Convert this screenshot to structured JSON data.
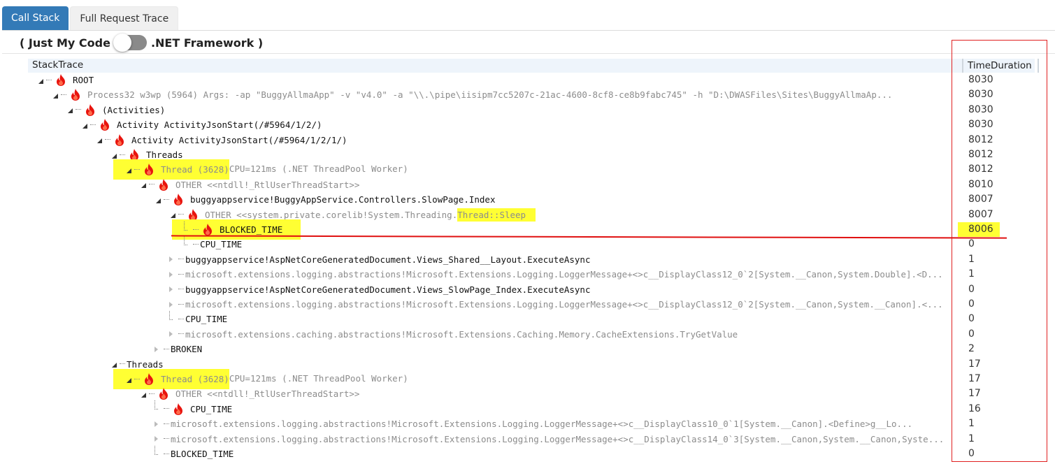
{
  "tabs": [
    {
      "label": "Call Stack",
      "active": true
    },
    {
      "label": "Full Request Trace",
      "active": false
    }
  ],
  "toggle": {
    "left_label": "( Just My Code",
    "right_label": ".NET Framework )",
    "state": "just-my-code"
  },
  "grid": {
    "columns": [
      "StackTrace",
      "TimeDuration"
    ],
    "rows": [
      {
        "label": "ROOT",
        "time": "8030",
        "depth": 0,
        "expander": "open",
        "flame": true,
        "style": "dark"
      },
      {
        "label": "Process32 w3wp (5964) Args: -ap \"BuggyAllmaApp\" -v \"v4.0\" -a \"\\\\.\\pipe\\iisipm7cc5207c-21ac-4600-8cf8-ce8b9fabc745\" -h \"D:\\DWASFiles\\Sites\\BuggyAllmaAp...",
        "time": "8030",
        "depth": 1,
        "expander": "open",
        "flame": true,
        "style": "grey"
      },
      {
        "label": "(Activities)",
        "time": "8030",
        "depth": 2,
        "expander": "open",
        "flame": true,
        "style": "dark"
      },
      {
        "label": "Activity ActivityJsonStart(/#5964/1/2/)",
        "time": "8030",
        "depth": 3,
        "expander": "open",
        "flame": true,
        "style": "dark"
      },
      {
        "label": "Activity ActivityJsonStart(/#5964/1/2/1/)",
        "time": "8012",
        "depth": 4,
        "expander": "open",
        "flame": true,
        "style": "dark"
      },
      {
        "label": "Threads",
        "time": "8012",
        "depth": 5,
        "expander": "open",
        "flame": true,
        "style": "dark"
      },
      {
        "label": "Thread (3628)",
        "label_suffix": " CPU=121ms (.NET ThreadPool Worker)",
        "time": "8012",
        "depth": 6,
        "expander": "open",
        "flame": true,
        "style": "grey",
        "highlight": "node"
      },
      {
        "label": "OTHER <<ntdll!_RtlUserThreadStart>>",
        "time": "8010",
        "depth": 7,
        "expander": "open",
        "flame": true,
        "style": "grey"
      },
      {
        "label": "buggyappservice!BuggyAppService.Controllers.SlowPage.Index",
        "time": "8007",
        "depth": 8,
        "expander": "open",
        "flame": true,
        "style": "dark"
      },
      {
        "label": "OTHER <<system.private.corelib!System.Threading.",
        "label_suffix": "Thread::Sleep",
        "time": "8007",
        "depth": 9,
        "expander": "open",
        "flame": true,
        "style": "grey",
        "highlight": "suffix"
      },
      {
        "label": "BLOCKED_TIME",
        "time": "8006",
        "depth": 10,
        "expander": "leaf",
        "flame": true,
        "style": "dark",
        "highlight": "node",
        "time_highlight": true
      },
      {
        "label": "CPU_TIME",
        "time": "0",
        "depth": 10,
        "expander": "leaf",
        "flame": false,
        "style": "dark"
      },
      {
        "label": "buggyappservice!AspNetCoreGeneratedDocument.Views_Shared__Layout.ExecuteAsync",
        "time": "1",
        "depth": 9,
        "expander": "closed",
        "flame": false,
        "style": "dark"
      },
      {
        "label": "microsoft.extensions.logging.abstractions!Microsoft.Extensions.Logging.LoggerMessage+<>c__DisplayClass12_0`2[System.__Canon,System.Double].<D...",
        "time": "1",
        "depth": 9,
        "expander": "closed",
        "flame": false,
        "style": "grey"
      },
      {
        "label": "buggyappservice!AspNetCoreGeneratedDocument.Views_SlowPage_Index.ExecuteAsync",
        "time": "0",
        "depth": 9,
        "expander": "closed",
        "flame": false,
        "style": "dark"
      },
      {
        "label": "microsoft.extensions.logging.abstractions!Microsoft.Extensions.Logging.LoggerMessage+<>c__DisplayClass12_0`2[System.__Canon,System.__Canon].<...",
        "time": "0",
        "depth": 9,
        "expander": "closed",
        "flame": false,
        "style": "grey"
      },
      {
        "label": "CPU_TIME",
        "time": "0",
        "depth": 9,
        "expander": "leaf",
        "flame": false,
        "style": "dark"
      },
      {
        "label": "microsoft.extensions.caching.abstractions!Microsoft.Extensions.Caching.Memory.CacheExtensions.TryGetValue",
        "time": "0",
        "depth": 9,
        "expander": "closed",
        "flame": false,
        "style": "grey"
      },
      {
        "label": "BROKEN",
        "time": "2",
        "depth": 8,
        "expander": "closed",
        "flame": false,
        "style": "dark"
      },
      {
        "label": "Threads",
        "time": "17",
        "depth": 5,
        "expander": "open",
        "flame": false,
        "style": "dark"
      },
      {
        "label": "Thread (3628)",
        "label_suffix": " CPU=121ms (.NET ThreadPool Worker)",
        "time": "17",
        "depth": 6,
        "expander": "open",
        "flame": true,
        "style": "grey",
        "highlight": "node"
      },
      {
        "label": "OTHER <<ntdll!_RtlUserThreadStart>>",
        "time": "17",
        "depth": 7,
        "expander": "open",
        "flame": true,
        "style": "grey"
      },
      {
        "label": "CPU_TIME",
        "time": "16",
        "depth": 8,
        "expander": "leaf",
        "flame": true,
        "style": "dark"
      },
      {
        "label": "microsoft.extensions.logging.abstractions!Microsoft.Extensions.Logging.LoggerMessage+<>c__DisplayClass10_0`1[System.__Canon].<Define>g__Lo...",
        "time": "1",
        "depth": 8,
        "expander": "closed",
        "flame": false,
        "style": "grey"
      },
      {
        "label": "microsoft.extensions.logging.abstractions!Microsoft.Extensions.Logging.LoggerMessage+<>c__DisplayClass14_0`3[System.__Canon,System.__Canon,Syste...",
        "time": "1",
        "depth": 8,
        "expander": "closed",
        "flame": false,
        "style": "grey"
      },
      {
        "label": "BLOCKED_TIME",
        "time": "0",
        "depth": 8,
        "expander": "leaf",
        "flame": false,
        "style": "dark"
      }
    ]
  },
  "annotations": {
    "highlight_color": "#ffff33",
    "box_color": "#e02020"
  },
  "colors": {
    "tab_active": "#337ab7",
    "flame": "#e8140e"
  }
}
